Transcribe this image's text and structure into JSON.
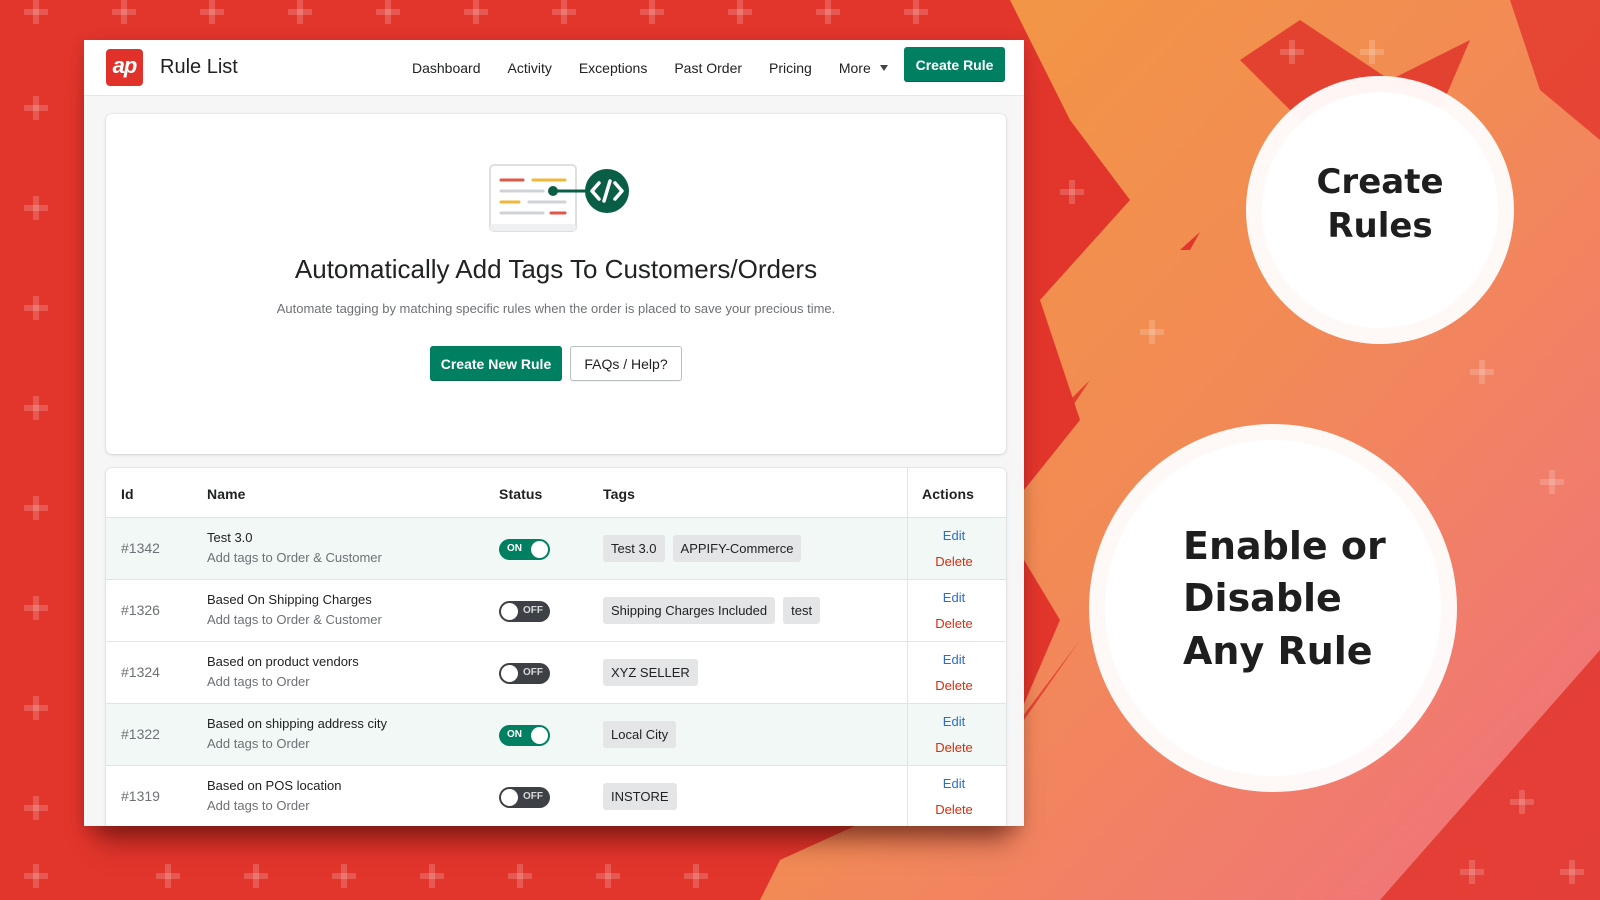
{
  "app": {
    "logo_text": "ap",
    "title": "Rule List"
  },
  "nav": {
    "items": [
      "Dashboard",
      "Activity",
      "Exceptions",
      "Past Order",
      "Pricing",
      "More"
    ],
    "create_rule_label": "Create Rule"
  },
  "hero": {
    "title": "Automatically Add Tags To Customers/Orders",
    "subtitle": "Automate tagging by matching specific rules when the order is placed to save your precious time.",
    "primary_button": "Create New Rule",
    "secondary_button": "FAQs / Help?"
  },
  "table": {
    "headers": {
      "id": "Id",
      "name": "Name",
      "status": "Status",
      "tags": "Tags",
      "actions": "Actions"
    },
    "edit_label": "Edit",
    "delete_label": "Delete",
    "on_label": "ON",
    "off_label": "OFF",
    "rows": [
      {
        "id": "#1342",
        "name": "Test 3.0",
        "description": "Add tags to Order & Customer",
        "enabled": true,
        "tags": [
          "Test 3.0",
          "APPIFY-Commerce"
        ]
      },
      {
        "id": "#1326",
        "name": "Based On Shipping Charges",
        "description": "Add tags to Order & Customer",
        "enabled": false,
        "tags": [
          "Shipping Charges Included",
          "test"
        ]
      },
      {
        "id": "#1324",
        "name": "Based on product vendors",
        "description": "Add tags to Order",
        "enabled": false,
        "tags": [
          "XYZ SELLER"
        ]
      },
      {
        "id": "#1322",
        "name": "Based on shipping address city",
        "description": "Add tags to Order",
        "enabled": true,
        "tags": [
          "Local City"
        ]
      },
      {
        "id": "#1319",
        "name": "Based on POS location",
        "description": "Add tags to Order",
        "enabled": false,
        "tags": [
          "INSTORE"
        ]
      }
    ]
  },
  "callouts": {
    "first": [
      "Create",
      "Rules"
    ],
    "second": [
      "Enable or",
      "Disable",
      "Any Rule"
    ]
  },
  "colors": {
    "brand_red": "#e0322a",
    "primary_green": "#008060",
    "toggle_off": "#3d4145",
    "link_blue": "#2c6ecb",
    "danger_red": "#d72c0d"
  }
}
